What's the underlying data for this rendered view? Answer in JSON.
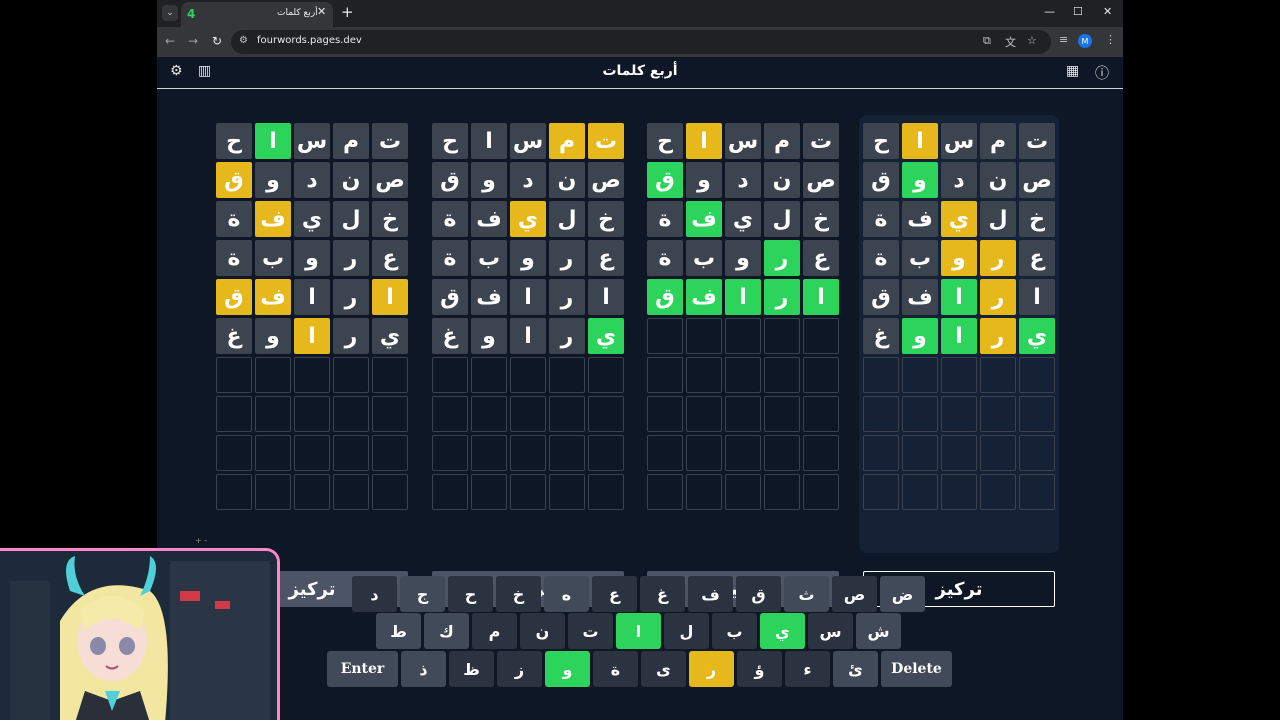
{
  "browser": {
    "tab_title": "أربع كلمات",
    "tab_close": "✕",
    "new_tab": "+",
    "url": "fourwords.pages.dev",
    "profile_initial": "M",
    "tab_dropdown": "⌄",
    "window_controls": {
      "minimize": "—",
      "maximize": "☐",
      "close": "✕"
    },
    "nav": {
      "back": "←",
      "forward": "→",
      "reload": "↻"
    }
  },
  "app": {
    "title": "أربع كلمات",
    "focus_label": "تركيز",
    "icons": {
      "settings": "⚙",
      "stats": "📊",
      "calendar": "📅",
      "info": "ⓘ"
    }
  },
  "boards": [
    {
      "active": true,
      "rows": [
        [
          "ت",
          "م",
          "س",
          "ا",
          "ح"
        ],
        [
          "ص",
          "ن",
          "د",
          "و",
          "ق"
        ],
        [
          "خ",
          "ل",
          "ي",
          "ف",
          "ة"
        ],
        [
          "ع",
          "ر",
          "و",
          "ب",
          "ة"
        ],
        [
          "ا",
          "ر",
          "ا",
          "ف",
          "ق"
        ],
        [
          "ي",
          "ر",
          "ا",
          "و",
          "غ"
        ]
      ],
      "states": [
        [
          "g",
          "g",
          "g",
          "y",
          "g"
        ],
        [
          "g",
          "g",
          "g",
          "G",
          "g"
        ],
        [
          "g",
          "g",
          "y",
          "g",
          "g"
        ],
        [
          "g",
          "y",
          "y",
          "g",
          "g"
        ],
        [
          "g",
          "y",
          "G",
          "g",
          "g"
        ],
        [
          "G",
          "y",
          "G",
          "G",
          "g"
        ]
      ]
    },
    {
      "active": false,
      "rows": [
        [
          "ت",
          "م",
          "س",
          "ا",
          "ح"
        ],
        [
          "ص",
          "ن",
          "د",
          "و",
          "ق"
        ],
        [
          "خ",
          "ل",
          "ي",
          "ف",
          "ة"
        ],
        [
          "ع",
          "ر",
          "و",
          "ب",
          "ة"
        ],
        [
          "ا",
          "ر",
          "ا",
          "ف",
          "ق"
        ],
        [],
        [],
        [],
        [],
        []
      ],
      "states": [
        [
          "g",
          "g",
          "g",
          "y",
          "g"
        ],
        [
          "g",
          "g",
          "g",
          "g",
          "G"
        ],
        [
          "g",
          "g",
          "g",
          "G",
          "g"
        ],
        [
          "g",
          "G",
          "g",
          "g",
          "g"
        ],
        [
          "G",
          "G",
          "G",
          "G",
          "G"
        ]
      ]
    },
    {
      "active": false,
      "rows": [
        [
          "ت",
          "م",
          "س",
          "ا",
          "ح"
        ],
        [
          "ص",
          "ن",
          "د",
          "و",
          "ق"
        ],
        [
          "خ",
          "ل",
          "ي",
          "ف",
          "ة"
        ],
        [
          "ع",
          "ر",
          "و",
          "ب",
          "ة"
        ],
        [
          "ا",
          "ر",
          "ا",
          "ف",
          "ق"
        ],
        [
          "ي",
          "ر",
          "ا",
          "و",
          "غ"
        ]
      ],
      "states": [
        [
          "y",
          "y",
          "g",
          "g",
          "g"
        ],
        [
          "g",
          "g",
          "g",
          "g",
          "g"
        ],
        [
          "g",
          "g",
          "y",
          "g",
          "g"
        ],
        [
          "g",
          "g",
          "g",
          "g",
          "g"
        ],
        [
          "g",
          "g",
          "g",
          "g",
          "g"
        ],
        [
          "G",
          "g",
          "g",
          "g",
          "g"
        ]
      ]
    },
    {
      "active": false,
      "rows": [
        [
          "ت",
          "م",
          "س",
          "ا",
          "ح"
        ],
        [
          "ص",
          "ن",
          "د",
          "و",
          "ق"
        ],
        [
          "خ",
          "ل",
          "ي",
          "ف",
          "ة"
        ],
        [
          "ع",
          "ر",
          "و",
          "ب",
          "ة"
        ],
        [
          "ا",
          "ر",
          "ا",
          "ف",
          "ق"
        ],
        [
          "ي",
          "ر",
          "ا",
          "و",
          "غ"
        ]
      ],
      "states": [
        [
          "g",
          "g",
          "g",
          "G",
          "g"
        ],
        [
          "g",
          "g",
          "g",
          "g",
          "y"
        ],
        [
          "g",
          "g",
          "g",
          "y",
          "g"
        ],
        [
          "g",
          "g",
          "g",
          "g",
          "g"
        ],
        [
          "y",
          "g",
          "g",
          "y",
          "y"
        ],
        [
          "g",
          "g",
          "y",
          "g",
          "g"
        ]
      ]
    }
  ],
  "keyboard": {
    "row1": [
      {
        "k": "ض",
        "s": "used"
      },
      {
        "k": "ص",
        "s": "none"
      },
      {
        "k": "ث",
        "s": "used"
      },
      {
        "k": "ق",
        "s": "none"
      },
      {
        "k": "ف",
        "s": "none"
      },
      {
        "k": "غ",
        "s": "none"
      },
      {
        "k": "ع",
        "s": "none"
      },
      {
        "k": "ه",
        "s": "used"
      },
      {
        "k": "خ",
        "s": "none"
      },
      {
        "k": "ح",
        "s": "none"
      },
      {
        "k": "ج",
        "s": "used"
      },
      {
        "k": "د",
        "s": "none"
      }
    ],
    "row2": [
      {
        "k": "ش",
        "s": "used"
      },
      {
        "k": "س",
        "s": "none"
      },
      {
        "k": "ي",
        "s": "green"
      },
      {
        "k": "ب",
        "s": "none"
      },
      {
        "k": "ل",
        "s": "none"
      },
      {
        "k": "ا",
        "s": "green"
      },
      {
        "k": "ت",
        "s": "none"
      },
      {
        "k": "ن",
        "s": "none"
      },
      {
        "k": "م",
        "s": "none"
      },
      {
        "k": "ك",
        "s": "used"
      },
      {
        "k": "ط",
        "s": "used"
      }
    ],
    "row3": [
      {
        "k": "Delete",
        "s": "wide"
      },
      {
        "k": "ئ",
        "s": "used"
      },
      {
        "k": "ء",
        "s": "none"
      },
      {
        "k": "ؤ",
        "s": "none"
      },
      {
        "k": "ر",
        "s": "yellow"
      },
      {
        "k": "ى",
        "s": "none"
      },
      {
        "k": "ة",
        "s": "none"
      },
      {
        "k": "و",
        "s": "green"
      },
      {
        "k": "ز",
        "s": "none"
      },
      {
        "k": "ظ",
        "s": "none"
      },
      {
        "k": "ذ",
        "s": "used"
      },
      {
        "k": "Enter",
        "s": "wide"
      }
    ]
  },
  "colors": {
    "bg": "#0e1726",
    "green": "#2dd45c",
    "yellow": "#e6b81c",
    "gray": "#3c4450"
  }
}
